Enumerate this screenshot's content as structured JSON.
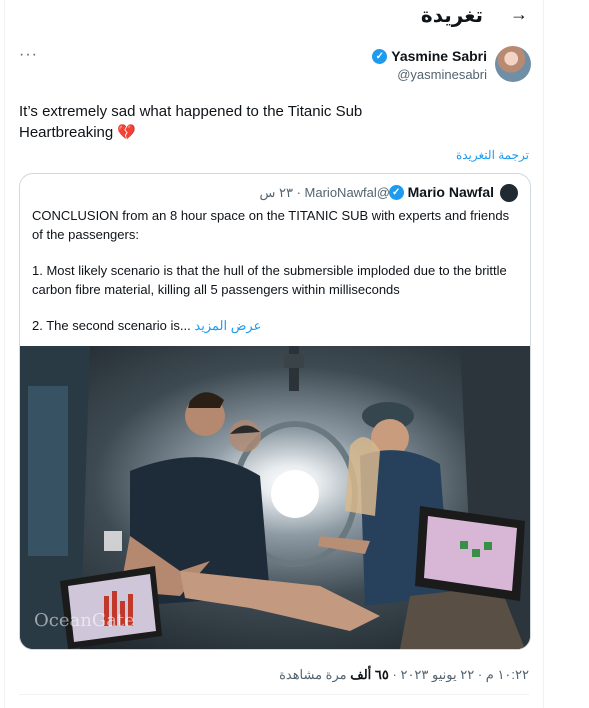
{
  "header": {
    "title": "تغريدة",
    "back_icon": "arrow-right-icon"
  },
  "tweet": {
    "author_name": "Yasmine Sabri",
    "author_handle": "@yasminesabri",
    "text_line1": "It’s extremely sad what happened to the Titanic Sub",
    "text_line2": "Heartbreaking",
    "emoji": "💔",
    "translate_label": "ترجمة التغريدة"
  },
  "quote": {
    "author_name": "Mario Nawfal",
    "author_handle": "@MarioNawfal",
    "time": "٢٣ س",
    "paragraph1": "CONCLUSION from an 8 hour space on the TITANIC SUB with experts and friends of the passengers:",
    "paragraph2": "1. Most likely scenario is that the hull of the submersible imploded due to the brittle carbon fibre material, killing all 5 passengers within milliseconds",
    "paragraph3": "2. The second scenario is...",
    "show_more": "عرض المزيد",
    "image_watermark": "OceanGate"
  },
  "footer": {
    "time": "١٠:٢٢ م",
    "date": "٢٢ يونيو ٢٠٢٣",
    "views_count": "٦٥ ألف",
    "views_label": "مرة مشاهدة"
  },
  "colors": {
    "accent": "#1d9bf0",
    "text": "#0f1419",
    "secondary": "#536471",
    "border": "#cfd9de",
    "heart": "#e0245e"
  }
}
